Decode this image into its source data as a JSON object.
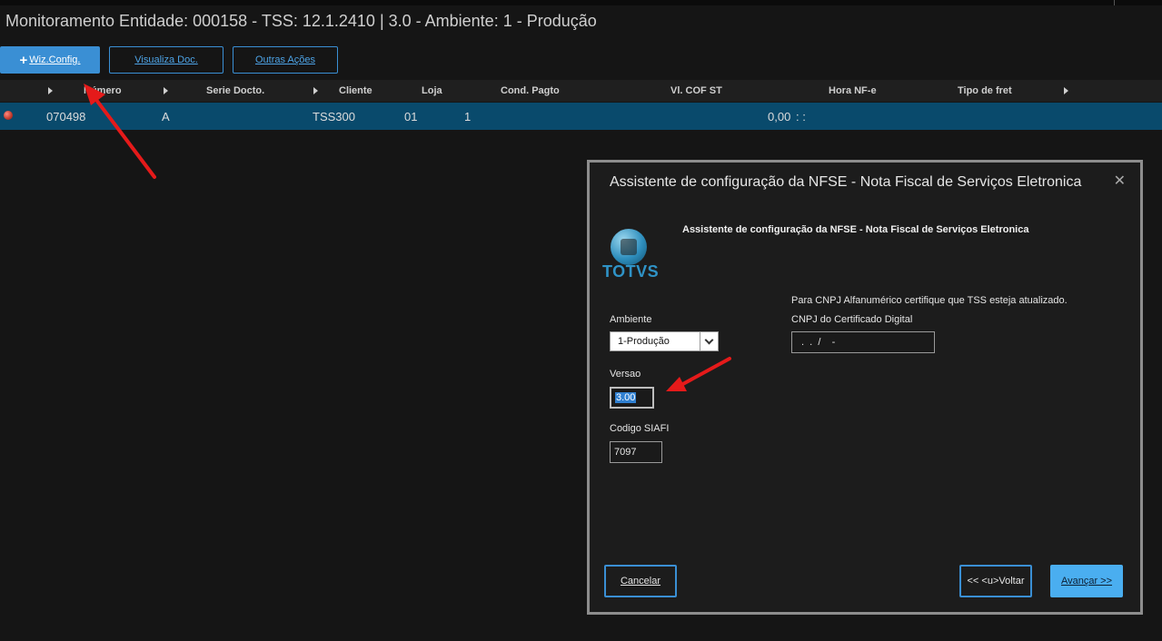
{
  "window": {
    "title": "Monitoramento Entidade: 000158 - TSS: 12.1.2410 | 3.0 - Ambiente: 1 - Produção"
  },
  "toolbar": {
    "wiz_config": {
      "icon": "plus-icon",
      "label": "Wiz.Config."
    },
    "visualiza_doc": "Visualiza Doc.",
    "outras_acoes": "Outras Ações"
  },
  "grid": {
    "columns": [
      "Número",
      "Serie Docto.",
      "Cliente",
      "Loja",
      "Cond. Pagto",
      "Vl. COF ST",
      "Hora NF-e",
      "Tipo de fret"
    ],
    "rows": [
      {
        "status_color": "#c0392b",
        "numero": "070498",
        "serie": "A",
        "cliente": "TSS300",
        "loja": "01",
        "cond_pagto": "1",
        "vl_cof_st": "0,00",
        "hora_nfe": ": :"
      }
    ]
  },
  "dialog": {
    "title": "Assistente de configuração da NFSE - Nota Fiscal de Serviços Eletronica",
    "subtitle": "Assistente de configuração da NFSE - Nota Fiscal de Serviços Eletronica",
    "logo_text": "TOTVS",
    "close_icon": "close-icon",
    "ambiente": {
      "label": "Ambiente",
      "value": "1-Produção"
    },
    "versao": {
      "label": "Versao",
      "value": "3.00"
    },
    "codigo_siafi": {
      "label": "Codigo SIAFI",
      "value": "7097"
    },
    "cnpj_note": "Para CNPJ Alfanumérico certifique que TSS esteja atualizado.",
    "cnpj": {
      "label": "CNPJ do Certificado Digital",
      "value": ".  .  /    -"
    },
    "buttons": {
      "cancelar": "Cancelar",
      "voltar": "<< <u>Voltar",
      "avancar": "Avançar >>"
    }
  },
  "colors": {
    "accent": "#3a8fd4",
    "selected_row": "#094a6c",
    "annotation_arrow": "#e51a1a"
  }
}
